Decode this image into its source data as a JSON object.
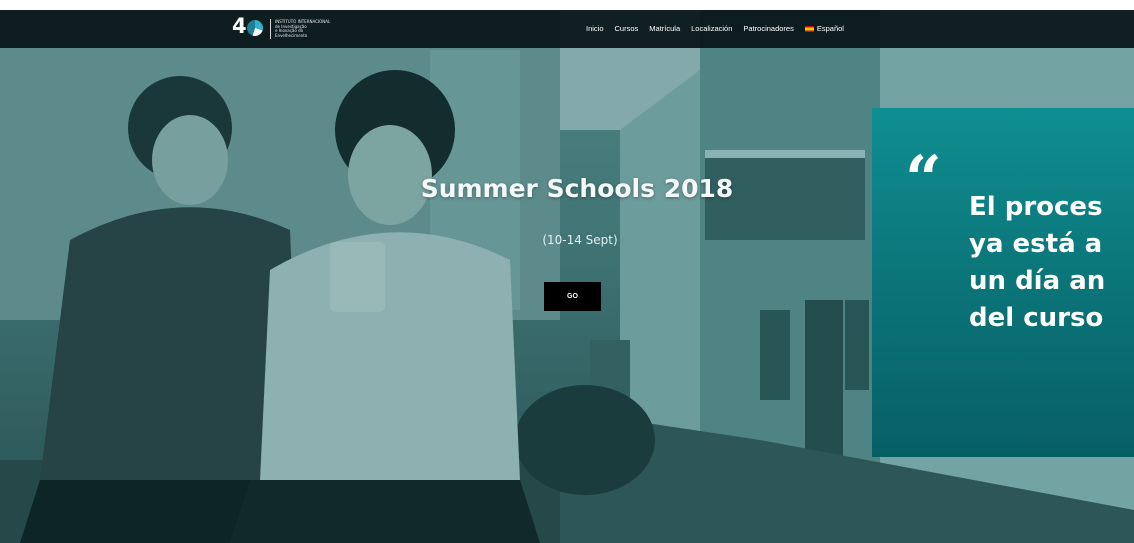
{
  "header": {
    "logo": {
      "lines": [
        "INSTITUTO INTERNACIONAL",
        "de Investigação",
        "e Inovação do",
        "Envelhecimento"
      ]
    },
    "nav": {
      "items": [
        "Inicio",
        "Cursos",
        "Matrícula",
        "Localización",
        "Patrocinadores"
      ],
      "language": "Español"
    }
  },
  "hero": {
    "title": "Summer Schools 2018",
    "subtitle": "(10-14 Sept)",
    "button_label": "GO"
  },
  "quote": {
    "mark": "“",
    "lines": [
      "El proces",
      "ya está a",
      "un día an",
      "del curso"
    ]
  },
  "colors": {
    "nav_background": "#081418",
    "quote_panel": "#0b777b",
    "hero_tint": "#4f8585",
    "button": "#000000"
  },
  "icons": {
    "logo": "4e-logo-icon",
    "language_flag": "spain-flag-icon",
    "quote": "quote-icon"
  }
}
